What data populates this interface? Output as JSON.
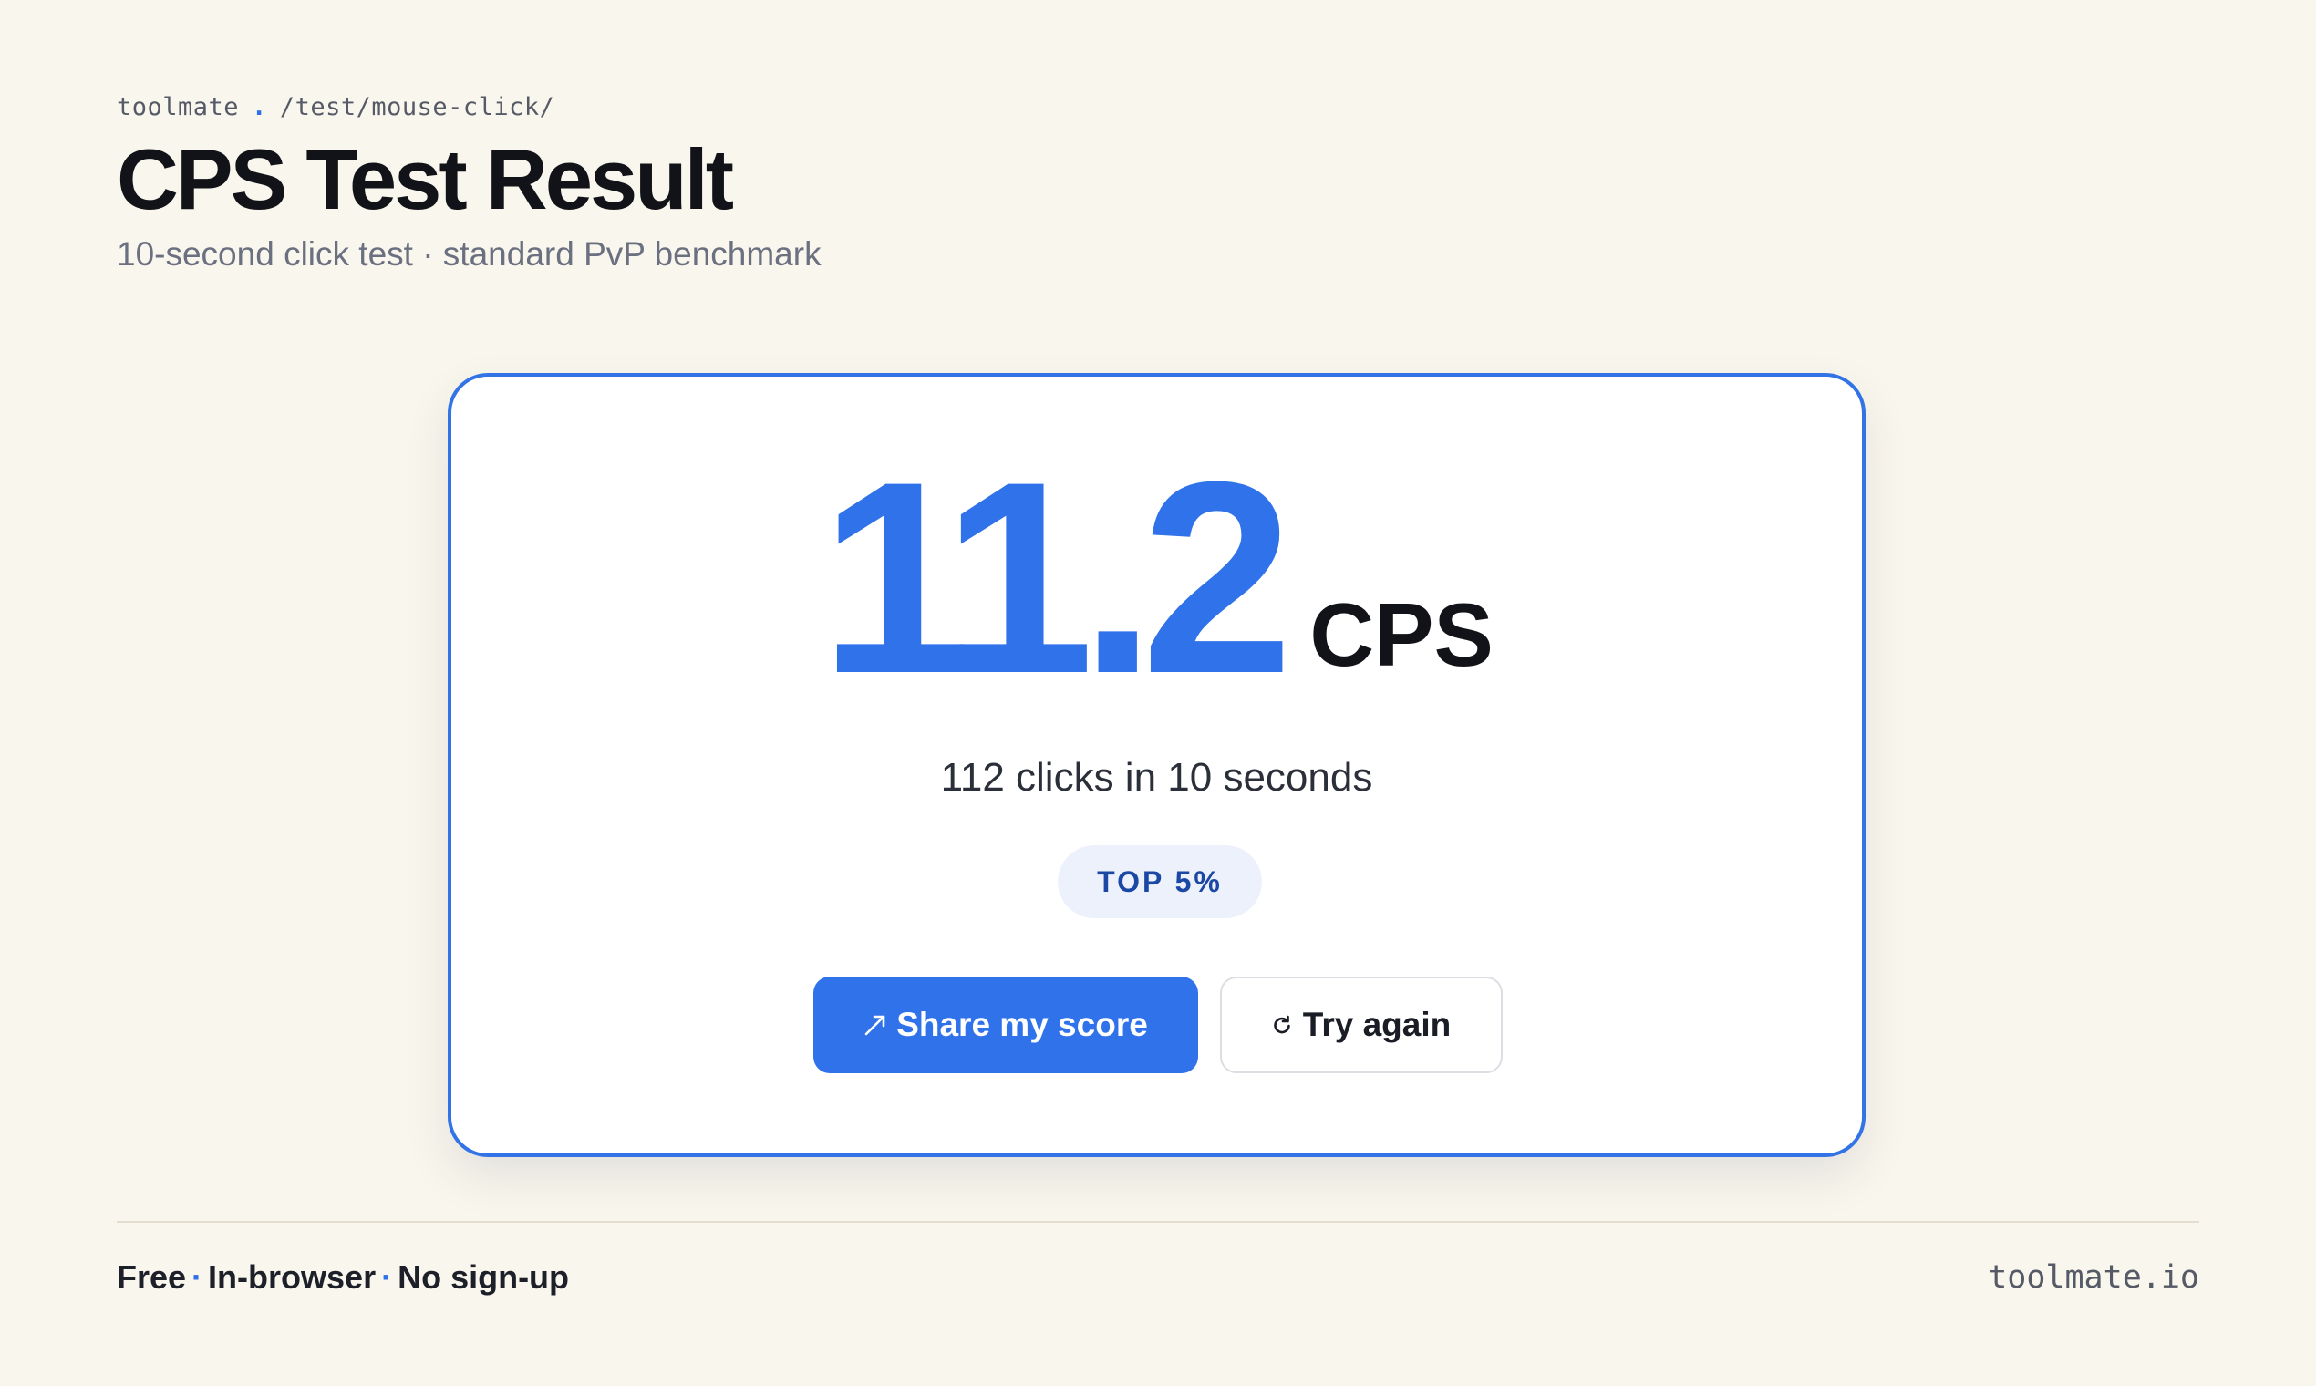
{
  "header": {
    "breadcrumb_site": "toolmate",
    "breadcrumb_separator": ".",
    "breadcrumb_path": "/test/mouse-click/",
    "title": "CPS Test Result",
    "subtitle": "10-second click test · standard PvP benchmark"
  },
  "result": {
    "score": "11.2",
    "unit": "CPS",
    "clicks_summary": "112 clicks in 10 seconds",
    "rank_badge": "TOP 5%"
  },
  "actions": {
    "share_label": "Share my score",
    "share_icon": "share-arrow-icon",
    "retry_label": "Try again",
    "retry_icon": "refresh-icon"
  },
  "footer": {
    "features": [
      "Free",
      "In-browser",
      "No sign-up"
    ],
    "feature_separator": "·",
    "domain": "toolmate.io"
  },
  "colors": {
    "accent": "#3072ea",
    "background": "#f9f6ed",
    "badge_background": "#edf1fb",
    "badge_text": "#1b47a5"
  }
}
